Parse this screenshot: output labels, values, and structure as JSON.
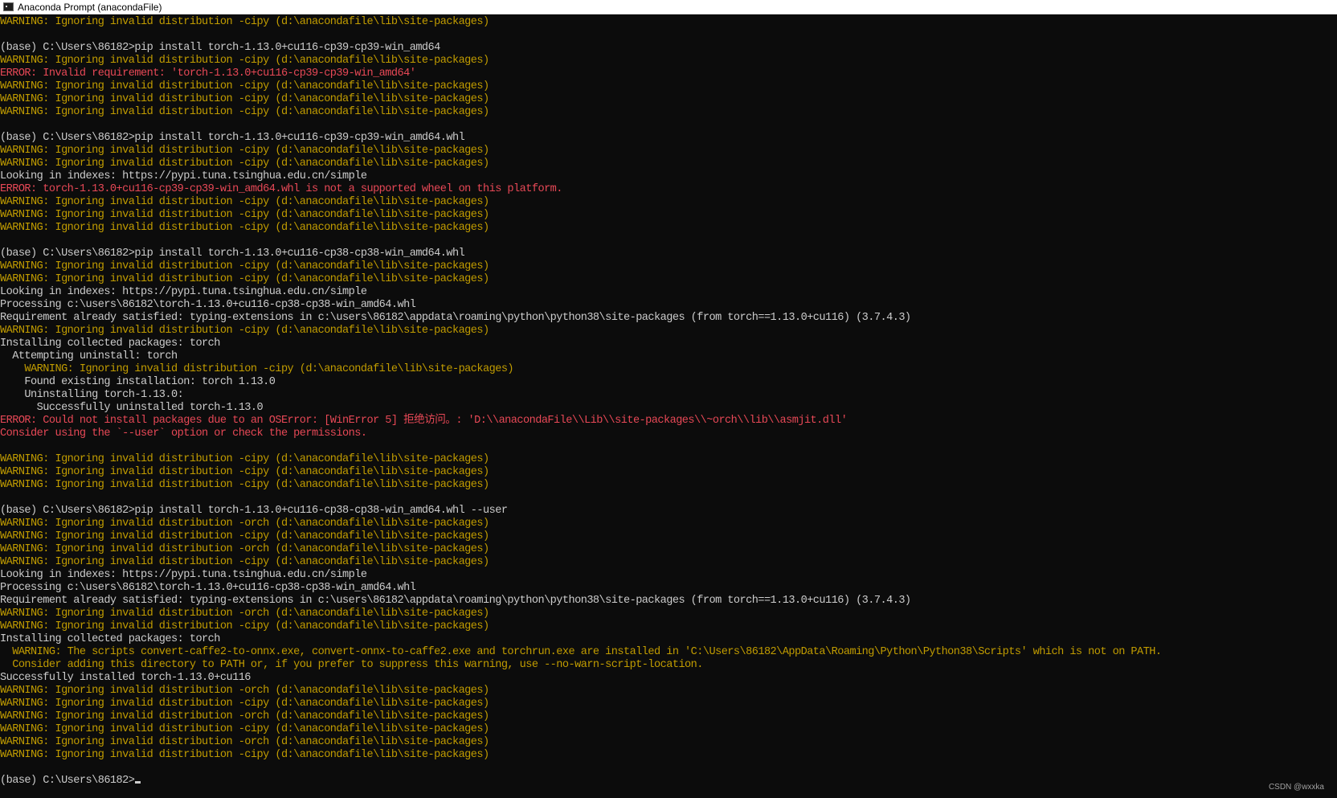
{
  "window": {
    "title": "Anaconda Prompt (anacondaFile)"
  },
  "colors": {
    "background": "#0c0c0c",
    "text": "#cccccc",
    "warning": "#c19c00",
    "error": "#e74856"
  },
  "console": {
    "lines": [
      {
        "type": "warn",
        "text": "WARNING: Ignoring invalid distribution -cipy (d:\\anacondafile\\lib\\site-packages)"
      },
      {
        "type": "blank",
        "text": ""
      },
      {
        "type": "normal",
        "text": "(base) C:\\Users\\86182>pip install torch-1.13.0+cu116-cp39-cp39-win_amd64"
      },
      {
        "type": "warn",
        "text": "WARNING: Ignoring invalid distribution -cipy (d:\\anacondafile\\lib\\site-packages)"
      },
      {
        "type": "err",
        "text": "ERROR: Invalid requirement: 'torch-1.13.0+cu116-cp39-cp39-win_amd64'"
      },
      {
        "type": "warn",
        "text": "WARNING: Ignoring invalid distribution -cipy (d:\\anacondafile\\lib\\site-packages)"
      },
      {
        "type": "warn",
        "text": "WARNING: Ignoring invalid distribution -cipy (d:\\anacondafile\\lib\\site-packages)"
      },
      {
        "type": "warn",
        "text": "WARNING: Ignoring invalid distribution -cipy (d:\\anacondafile\\lib\\site-packages)"
      },
      {
        "type": "blank",
        "text": ""
      },
      {
        "type": "normal",
        "text": "(base) C:\\Users\\86182>pip install torch-1.13.0+cu116-cp39-cp39-win_amd64.whl"
      },
      {
        "type": "warn",
        "text": "WARNING: Ignoring invalid distribution -cipy (d:\\anacondafile\\lib\\site-packages)"
      },
      {
        "type": "warn",
        "text": "WARNING: Ignoring invalid distribution -cipy (d:\\anacondafile\\lib\\site-packages)"
      },
      {
        "type": "normal",
        "text": "Looking in indexes: https://pypi.tuna.tsinghua.edu.cn/simple"
      },
      {
        "type": "err",
        "text": "ERROR: torch-1.13.0+cu116-cp39-cp39-win_amd64.whl is not a supported wheel on this platform."
      },
      {
        "type": "warn",
        "text": "WARNING: Ignoring invalid distribution -cipy (d:\\anacondafile\\lib\\site-packages)"
      },
      {
        "type": "warn",
        "text": "WARNING: Ignoring invalid distribution -cipy (d:\\anacondafile\\lib\\site-packages)"
      },
      {
        "type": "warn",
        "text": "WARNING: Ignoring invalid distribution -cipy (d:\\anacondafile\\lib\\site-packages)"
      },
      {
        "type": "blank",
        "text": ""
      },
      {
        "type": "normal",
        "text": "(base) C:\\Users\\86182>pip install torch-1.13.0+cu116-cp38-cp38-win_amd64.whl"
      },
      {
        "type": "warn",
        "text": "WARNING: Ignoring invalid distribution -cipy (d:\\anacondafile\\lib\\site-packages)"
      },
      {
        "type": "warn",
        "text": "WARNING: Ignoring invalid distribution -cipy (d:\\anacondafile\\lib\\site-packages)"
      },
      {
        "type": "normal",
        "text": "Looking in indexes: https://pypi.tuna.tsinghua.edu.cn/simple"
      },
      {
        "type": "normal",
        "text": "Processing c:\\users\\86182\\torch-1.13.0+cu116-cp38-cp38-win_amd64.whl"
      },
      {
        "type": "normal",
        "text": "Requirement already satisfied: typing-extensions in c:\\users\\86182\\appdata\\roaming\\python\\python38\\site-packages (from torch==1.13.0+cu116) (3.7.4.3)"
      },
      {
        "type": "warn",
        "text": "WARNING: Ignoring invalid distribution -cipy (d:\\anacondafile\\lib\\site-packages)"
      },
      {
        "type": "normal",
        "text": "Installing collected packages: torch"
      },
      {
        "type": "normal",
        "text": "  Attempting uninstall: torch"
      },
      {
        "type": "warn",
        "text": "    WARNING: Ignoring invalid distribution -cipy (d:\\anacondafile\\lib\\site-packages)"
      },
      {
        "type": "normal",
        "text": "    Found existing installation: torch 1.13.0"
      },
      {
        "type": "normal",
        "text": "    Uninstalling torch-1.13.0:"
      },
      {
        "type": "normal",
        "text": "      Successfully uninstalled torch-1.13.0"
      },
      {
        "type": "err",
        "text": "ERROR: Could not install packages due to an OSError: [WinError 5] 拒绝访问。: 'D:\\\\anacondaFile\\\\Lib\\\\site-packages\\\\~orch\\\\lib\\\\asmjit.dll'"
      },
      {
        "type": "err",
        "text": "Consider using the `--user` option or check the permissions."
      },
      {
        "type": "blank",
        "text": ""
      },
      {
        "type": "warn",
        "text": "WARNING: Ignoring invalid distribution -cipy (d:\\anacondafile\\lib\\site-packages)"
      },
      {
        "type": "warn",
        "text": "WARNING: Ignoring invalid distribution -cipy (d:\\anacondafile\\lib\\site-packages)"
      },
      {
        "type": "warn",
        "text": "WARNING: Ignoring invalid distribution -cipy (d:\\anacondafile\\lib\\site-packages)"
      },
      {
        "type": "blank",
        "text": ""
      },
      {
        "type": "normal",
        "text": "(base) C:\\Users\\86182>pip install torch-1.13.0+cu116-cp38-cp38-win_amd64.whl --user"
      },
      {
        "type": "warn",
        "text": "WARNING: Ignoring invalid distribution -orch (d:\\anacondafile\\lib\\site-packages)"
      },
      {
        "type": "warn",
        "text": "WARNING: Ignoring invalid distribution -cipy (d:\\anacondafile\\lib\\site-packages)"
      },
      {
        "type": "warn",
        "text": "WARNING: Ignoring invalid distribution -orch (d:\\anacondafile\\lib\\site-packages)"
      },
      {
        "type": "warn",
        "text": "WARNING: Ignoring invalid distribution -cipy (d:\\anacondafile\\lib\\site-packages)"
      },
      {
        "type": "normal",
        "text": "Looking in indexes: https://pypi.tuna.tsinghua.edu.cn/simple"
      },
      {
        "type": "normal",
        "text": "Processing c:\\users\\86182\\torch-1.13.0+cu116-cp38-cp38-win_amd64.whl"
      },
      {
        "type": "normal",
        "text": "Requirement already satisfied: typing-extensions in c:\\users\\86182\\appdata\\roaming\\python\\python38\\site-packages (from torch==1.13.0+cu116) (3.7.4.3)"
      },
      {
        "type": "warn",
        "text": "WARNING: Ignoring invalid distribution -orch (d:\\anacondafile\\lib\\site-packages)"
      },
      {
        "type": "warn",
        "text": "WARNING: Ignoring invalid distribution -cipy (d:\\anacondafile\\lib\\site-packages)"
      },
      {
        "type": "normal",
        "text": "Installing collected packages: torch"
      },
      {
        "type": "warn",
        "text": "  WARNING: The scripts convert-caffe2-to-onnx.exe, convert-onnx-to-caffe2.exe and torchrun.exe are installed in 'C:\\Users\\86182\\AppData\\Roaming\\Python\\Python38\\Scripts' which is not on PATH."
      },
      {
        "type": "warn",
        "text": "  Consider adding this directory to PATH or, if you prefer to suppress this warning, use --no-warn-script-location."
      },
      {
        "type": "normal",
        "text": "Successfully installed torch-1.13.0+cu116"
      },
      {
        "type": "warn",
        "text": "WARNING: Ignoring invalid distribution -orch (d:\\anacondafile\\lib\\site-packages)"
      },
      {
        "type": "warn",
        "text": "WARNING: Ignoring invalid distribution -cipy (d:\\anacondafile\\lib\\site-packages)"
      },
      {
        "type": "warn",
        "text": "WARNING: Ignoring invalid distribution -orch (d:\\anacondafile\\lib\\site-packages)"
      },
      {
        "type": "warn",
        "text": "WARNING: Ignoring invalid distribution -cipy (d:\\anacondafile\\lib\\site-packages)"
      },
      {
        "type": "warn",
        "text": "WARNING: Ignoring invalid distribution -orch (d:\\anacondafile\\lib\\site-packages)"
      },
      {
        "type": "warn",
        "text": "WARNING: Ignoring invalid distribution -cipy (d:\\anacondafile\\lib\\site-packages)"
      },
      {
        "type": "blank",
        "text": ""
      }
    ],
    "prompt": "(base) C:\\Users\\86182>"
  },
  "watermark": "CSDN @wxxka"
}
